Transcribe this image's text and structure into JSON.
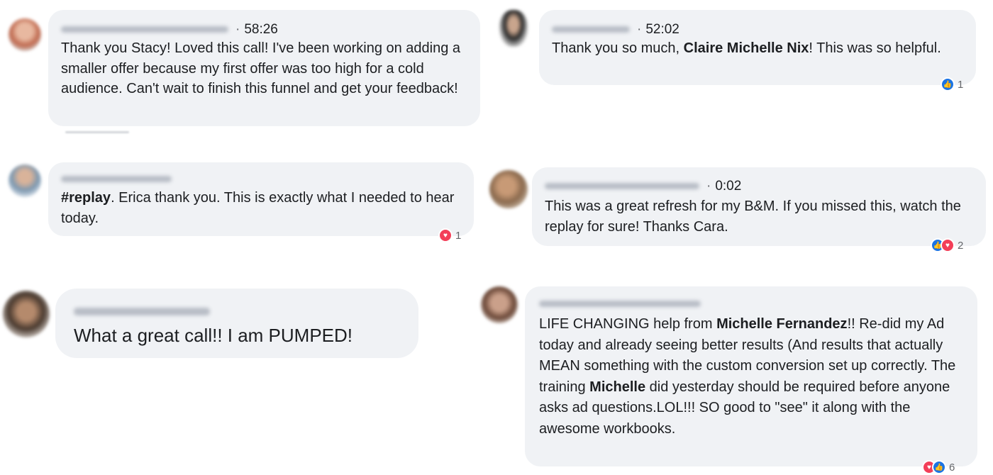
{
  "comments": [
    {
      "timestamp": "58:26",
      "segments": [
        {
          "text": "Thank you Stacy! Loved this call! I've been working on adding a smaller offer because my first offer was too high for a cold audience. Can't wait to finish this funnel and get your feedback!",
          "bold": false
        }
      ]
    },
    {
      "timestamp": "52:02",
      "segments": [
        {
          "text": "Thank you so much, ",
          "bold": false
        },
        {
          "text": "Claire Michelle Nix",
          "bold": true
        },
        {
          "text": "! This was so helpful.",
          "bold": false
        }
      ],
      "reactions": {
        "icons": [
          "like-icon"
        ],
        "count": "1"
      }
    },
    {
      "timestamp": "",
      "segments": [
        {
          "text": "#replay",
          "bold": true
        },
        {
          "text": ". Erica thank you. This is exactly what I needed to hear today.",
          "bold": false
        }
      ],
      "reactions": {
        "icons": [
          "love-icon"
        ],
        "count": "1"
      }
    },
    {
      "timestamp": "0:02",
      "segments": [
        {
          "text": "This was a great refresh for my B&M. If you missed this, watch the replay for sure! Thanks Cara.",
          "bold": false
        }
      ],
      "reactions": {
        "icons": [
          "like-icon",
          "love-icon"
        ],
        "count": "2"
      }
    },
    {
      "timestamp": "",
      "segments": [
        {
          "text": "What a great call!! I am PUMPED!",
          "bold": false
        }
      ]
    },
    {
      "timestamp": "",
      "segments": [
        {
          "text": "LIFE CHANGING help from ",
          "bold": false
        },
        {
          "text": "Michelle Fernandez",
          "bold": true
        },
        {
          "text": "!! Re-did my Ad today and already seeing better results (And results that actually MEAN something with the custom conversion set up correctly. The training ",
          "bold": false
        },
        {
          "text": "Michelle",
          "bold": true
        },
        {
          "text": " did yesterday should be required before anyone asks ad questions.LOL!!! SO good to \"see\" it along with the awesome workbooks.",
          "bold": false
        }
      ],
      "reactions": {
        "icons": [
          "love-icon",
          "like-icon"
        ],
        "count": "6"
      }
    }
  ],
  "meta_separator": "·",
  "colors": {
    "bubble": "#f0f2f5",
    "like": "#1b74e4",
    "love": "#f33e58",
    "secondary_text": "#65676b"
  }
}
